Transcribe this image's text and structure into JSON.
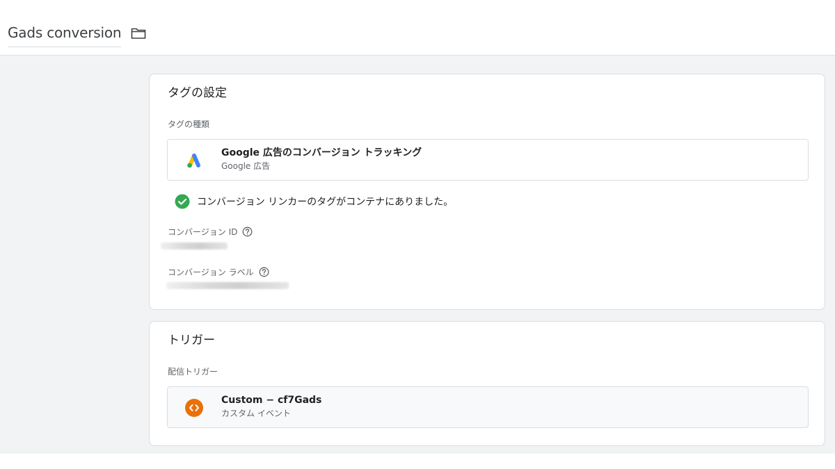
{
  "header": {
    "title": "Gads conversion",
    "folder_icon": "folder-icon"
  },
  "tag_config": {
    "title": "タグの設定",
    "type_label": "タグの種類",
    "tag_type": {
      "name": "Google 広告のコンバージョン トラッキング",
      "vendor": "Google 広告",
      "icon": "google-ads-icon"
    },
    "status": {
      "text": "コンバージョン リンカーのタグがコンテナにありました。",
      "icon": "check-circle-icon",
      "color": "#34a853"
    },
    "conversion_id_label": "コンバージョン ID",
    "conversion_label_label": "コンバージョン ラベル",
    "help_icon": "help-circle-icon"
  },
  "triggers": {
    "title": "トリガー",
    "firing_label": "配信トリガー",
    "trigger": {
      "name": "Custom − cf7Gads",
      "type": "カスタム イベント",
      "icon": "custom-event-icon",
      "color": "#e8710a"
    }
  },
  "colors": {
    "ads_blue": "#4285f4",
    "ads_yellow": "#fbbc04",
    "ads_green": "#34a853",
    "background": "#f1f3f4"
  }
}
